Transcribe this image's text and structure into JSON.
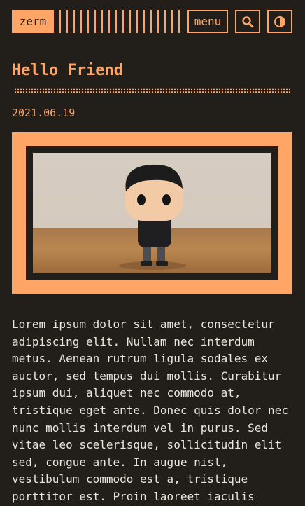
{
  "header": {
    "logo": "zerm",
    "menu_label": "menu",
    "search_icon": "search-icon",
    "theme_icon": "contrast-icon"
  },
  "post": {
    "title": "Hello Friend",
    "date": "2021.06.19",
    "image_subject": "figurine on wooden table",
    "content": "Lorem ipsum dolor sit amet, consectetur\nadipiscing elit. Nullam nec interdum\nmetus. Aenean rutrum ligula sodales ex\nauctor, sed tempus dui mollis. Curabitur\nipsum dui, aliquet nec commodo at,\ntristique eget ante. Donec quis dolor nec\nnunc mollis interdum vel in purus. Sed\nvitae leo scelerisque, sollicitudin elit\nsed, congue ante. In augue nisl,\nvestibulum commodo est a, tristique\nporttitor est. Proin laoreet iaculis"
  },
  "colors": {
    "background": "#221f1a",
    "accent": "#ffa566",
    "text": "#eae6dd"
  }
}
